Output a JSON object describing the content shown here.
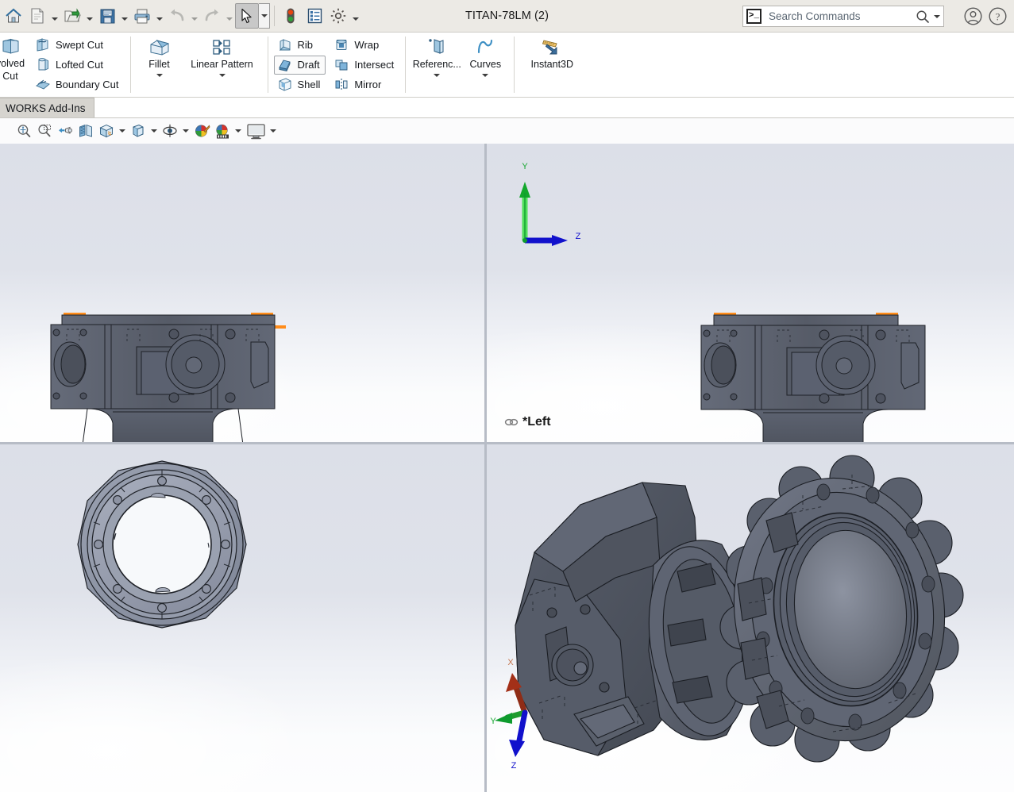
{
  "window": {
    "title": "TITAN-78LM (2)"
  },
  "quick_access": {
    "buttons": [
      {
        "name": "home-button",
        "icon": "home-icon",
        "has_dropdown": false,
        "pressed": false
      },
      {
        "name": "new-document-button",
        "icon": "new-file-icon",
        "has_dropdown": true,
        "pressed": false
      },
      {
        "name": "open-document-button",
        "icon": "open-folder-icon",
        "has_dropdown": true,
        "pressed": false
      },
      {
        "name": "save-button",
        "icon": "save-floppy-icon",
        "has_dropdown": true,
        "pressed": false
      },
      {
        "name": "print-button",
        "icon": "printer-icon",
        "has_dropdown": true,
        "pressed": false
      },
      {
        "name": "undo-button",
        "icon": "undo-arrow-icon",
        "has_dropdown": true,
        "pressed": false
      },
      {
        "name": "redo-button",
        "icon": "redo-arrow-icon",
        "has_dropdown": true,
        "pressed": false
      },
      {
        "name": "select-tool-button",
        "icon": "cursor-arrow-icon",
        "has_dropdown": true,
        "pressed": true
      },
      {
        "name": "rebuild-button",
        "icon": "traffic-light-icon",
        "has_dropdown": false,
        "pressed": false
      },
      {
        "name": "file-properties-button",
        "icon": "properties-list-icon",
        "has_dropdown": false,
        "pressed": false
      },
      {
        "name": "options-button",
        "icon": "gear-icon",
        "has_dropdown": true,
        "pressed": false
      }
    ]
  },
  "search": {
    "placeholder": "Search Commands",
    "icon": "command-prompt-icon",
    "magnifier": "magnifier-icon",
    "dropdown": "chevron-down-icon"
  },
  "account": {
    "icon": "user-account-icon"
  },
  "help": {
    "icon": "help-question-icon"
  },
  "ribbon": {
    "groups": [
      {
        "name": "cut-features-group",
        "big": [
          {
            "label_line1": "volved",
            "label_line2": "Cut",
            "icon": "revolved-cut-icon",
            "truncated": true
          }
        ],
        "stack": [
          {
            "label": "Swept Cut",
            "icon": "swept-cut-icon",
            "hover": false
          },
          {
            "label": "Lofted Cut",
            "icon": "lofted-cut-icon",
            "hover": false
          },
          {
            "label": "Boundary Cut",
            "icon": "boundary-cut-icon",
            "hover": false
          }
        ]
      },
      {
        "name": "fillet-pattern-group",
        "big": [
          {
            "label_line1": "Fillet",
            "label_line2": "",
            "icon": "fillet-icon",
            "has_dropdown": true
          },
          {
            "label_line1": "Linear Pattern",
            "label_line2": "",
            "icon": "linear-pattern-icon",
            "has_dropdown": true
          }
        ]
      },
      {
        "name": "modeling-tools-group",
        "stack_a": [
          {
            "label": "Rib",
            "icon": "rib-icon",
            "hover": false
          },
          {
            "label": "Draft",
            "icon": "draft-icon",
            "hover": true
          },
          {
            "label": "Shell",
            "icon": "shell-icon",
            "hover": false
          }
        ],
        "stack_b": [
          {
            "label": "Wrap",
            "icon": "wrap-icon",
            "hover": false
          },
          {
            "label": "Intersect",
            "icon": "intersect-icon",
            "hover": false
          },
          {
            "label": "Mirror",
            "icon": "mirror-icon",
            "hover": false
          }
        ]
      },
      {
        "name": "reference-curves-group",
        "big": [
          {
            "label_line1": "Referenc...",
            "label_line2": "",
            "icon": "reference-geometry-icon",
            "has_dropdown": true
          },
          {
            "label_line1": "Curves",
            "label_line2": "",
            "icon": "curves-icon",
            "has_dropdown": true
          }
        ]
      },
      {
        "name": "instant3d-group",
        "big": [
          {
            "label_line1": "Instant3D",
            "label_line2": "",
            "icon": "instant3d-icon",
            "has_dropdown": false
          }
        ]
      }
    ]
  },
  "tabs": {
    "active": "WORKS Add-Ins"
  },
  "view_toolbar": {
    "buttons": [
      {
        "name": "zoom-to-fit-button",
        "icon": "zoom-to-fit-icon",
        "dropdown": false
      },
      {
        "name": "zoom-to-area-button",
        "icon": "zoom-to-area-icon",
        "dropdown": false
      },
      {
        "name": "previous-view-button",
        "icon": "previous-view-icon",
        "dropdown": false
      },
      {
        "name": "section-view-button",
        "icon": "section-view-icon",
        "dropdown": false
      },
      {
        "name": "view-orientation-button",
        "icon": "view-orientation-icon",
        "dropdown": false
      },
      {
        "name": "display-style-button",
        "icon": "display-style-icon",
        "dropdown": true
      },
      {
        "name": "hide-show-items-button",
        "icon": "hide-show-cube-icon",
        "dropdown": true
      },
      {
        "name": "edit-appearance-button",
        "icon": "eye-appearance-icon",
        "dropdown": true
      },
      {
        "name": "apply-scene-button",
        "icon": "apply-scene-icon",
        "dropdown": false
      },
      {
        "name": "view-settings-button",
        "icon": "view-settings-icon",
        "dropdown": true
      },
      {
        "name": "viewport-layout-button",
        "icon": "monitor-viewport-icon",
        "dropdown": true
      }
    ]
  },
  "viewports": [
    {
      "name": "viewport-top-left",
      "view_label": "",
      "has_label": false,
      "has_triad": false,
      "model": "gearbox-housing-front-view"
    },
    {
      "name": "viewport-top-right",
      "view_label": "*Left",
      "has_label": true,
      "has_triad": true,
      "triad_type": "left-orthographic",
      "triad_axes": [
        {
          "axis": "Y",
          "color": "#00a63c",
          "direction": "up"
        },
        {
          "axis": "Z",
          "color": "#1111cc",
          "direction": "right"
        }
      ],
      "model": "gearbox-housing-left-view"
    },
    {
      "name": "viewport-bottom-left",
      "view_label": "",
      "has_label": false,
      "has_triad": false,
      "model": "hub-flange-axial-view"
    },
    {
      "name": "viewport-bottom-right",
      "view_label": "",
      "has_label": false,
      "has_triad": true,
      "triad_type": "isometric",
      "triad_axes": [
        {
          "axis": "X",
          "color": "#a33018",
          "direction": "up-left"
        },
        {
          "axis": "Y",
          "color": "#0f9b2e",
          "direction": "left"
        },
        {
          "axis": "Z",
          "color": "#1111cc",
          "direction": "down"
        }
      ],
      "model": "hub-sprocket-assembly-isometric"
    }
  ],
  "colors": {
    "model_body": "#5b606a",
    "model_light": "#8d93a1",
    "model_dark": "#3f434c",
    "highlight_orange": "#ff8c1a",
    "viewport_bg_top": "#dcdfe8",
    "viewport_bg_bottom": "#fbfcfd",
    "ribbon_bg": "#ffffff",
    "titlebar_bg": "#eceae5",
    "splitter": "#b7bcc6",
    "axis_x": "#a33018",
    "axis_y": "#0f9b2e",
    "axis_z": "#1111cc"
  }
}
